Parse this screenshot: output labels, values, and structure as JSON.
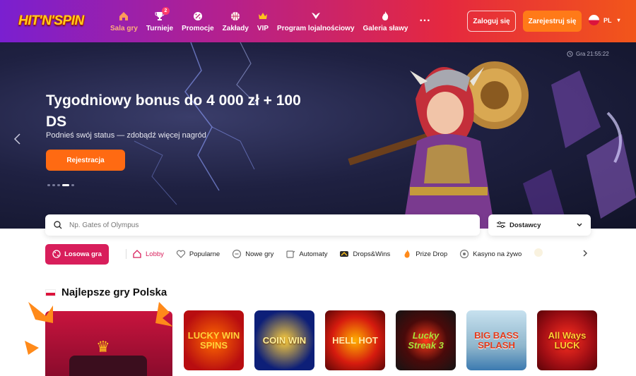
{
  "header": {
    "logo_text": "HIT'N'SPIN",
    "nav": [
      {
        "label": "Sala gry",
        "icon": "home-icon",
        "active": true
      },
      {
        "label": "Turnieje",
        "icon": "trophy-icon",
        "badge": "2"
      },
      {
        "label": "Promocje",
        "icon": "promo-icon"
      },
      {
        "label": "Zakłady",
        "icon": "basketball-icon"
      },
      {
        "label": "VIP",
        "icon": "crown-icon"
      },
      {
        "label": "Program lojalnościowy",
        "icon": "wings-icon"
      },
      {
        "label": "Galeria sławy",
        "icon": "fire-icon"
      }
    ],
    "more": "···",
    "login_label": "Zaloguj się",
    "register_label": "Zarejestruj się",
    "language": "PL"
  },
  "hero": {
    "title": "Tygodniowy bonus do 4 000 zł + 100 DS",
    "subtitle": "Podnieś swój status — zdobądź więcej nagród",
    "cta_label": "Rejestracja",
    "timer_text": "Gra 21:55:22"
  },
  "search": {
    "placeholder": "Np. Gates of Olympus",
    "value": ""
  },
  "providers": {
    "label": "Dostawcy"
  },
  "categories": {
    "random_label": "Losowa gra",
    "items": [
      {
        "label": "Lobby",
        "icon": "home-icon",
        "active": true
      },
      {
        "label": "Popularne",
        "icon": "heart-icon"
      },
      {
        "label": "Nowe gry",
        "icon": "new-icon"
      },
      {
        "label": "Automaty",
        "icon": "slot-machine-icon"
      },
      {
        "label": "Drops&Wins",
        "icon": "drops-wins-icon"
      },
      {
        "label": "Prize Drop",
        "icon": "flame-icon"
      },
      {
        "label": "Kasyno na żywo",
        "icon": "live-icon"
      }
    ]
  },
  "section": {
    "title": "Najlepsze gry Polska"
  },
  "games": [
    {
      "name": "LUCKY WIN SPINS",
      "bg": "#c8101a",
      "fg": "#ffd23a"
    },
    {
      "name": "COIN WIN",
      "bg": "#0d1f78",
      "fg": "#ffd23a"
    },
    {
      "name": "HELL HOT",
      "bg": "#d61b0e",
      "fg": "#ffd27a"
    },
    {
      "name": "Lucky Streak 3",
      "bg": "#141414",
      "fg": "#8cd42a"
    },
    {
      "name": "BIG BASS SPLASH",
      "bg": "#9ec3d8",
      "fg": "#e33a1a"
    },
    {
      "name": "All Ways LUCK",
      "bg": "#a10e14",
      "fg": "#ffcf33"
    }
  ],
  "colors": {
    "accent_orange": "#ff6a12",
    "accent_pink": "#d81e5b",
    "header_start": "#7a1fd0",
    "header_end": "#f2561a"
  }
}
